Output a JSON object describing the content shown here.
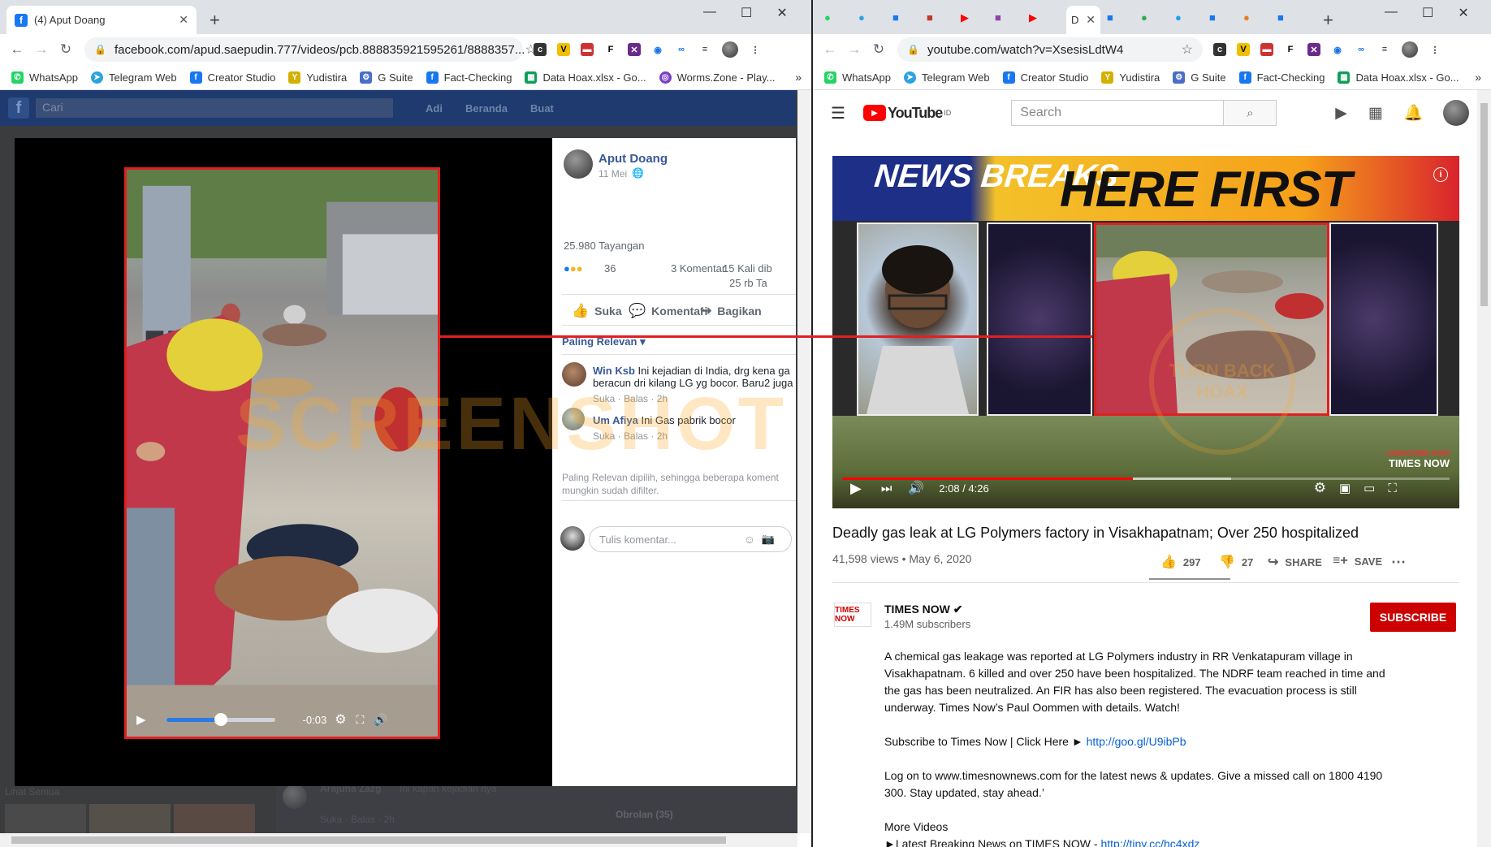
{
  "left": {
    "tab_title": "(4) Aput Doang",
    "url": "facebook.com/apud.saepudin.777/videos/pcb.888835921595261/8888357...",
    "bookmarks": [
      "WhatsApp",
      "Telegram Web",
      "Creator Studio",
      "Yudistira",
      "G Suite",
      "Fact-Checking",
      "Data Hoax.xlsx - Go...",
      "Worms.Zone - Play..."
    ],
    "fb_header": {
      "search": "Cari",
      "user": "Adi",
      "home": "Beranda",
      "create": "Buat"
    },
    "video": {
      "time": "-0:03",
      "progress": 0.5
    },
    "post": {
      "author": "Aput Doang",
      "date": "11 Mei",
      "views": "25.980 Tayangan",
      "reactions": "36",
      "comments": "3 Komentar",
      "shares": "15 Kali dib",
      "views2": "25 rb Ta",
      "like": "Suka",
      "comment": "Komentari",
      "share": "Bagikan",
      "sort": "Paling Relevan ▾",
      "comment_list": [
        {
          "author": "Win Ksb",
          "text": "Ini kejadian di India, drg kena ga",
          "text2": "beracun dri kilang LG yg bocor. Baru2 juga",
          "meta": "Suka · Balas · 2h"
        },
        {
          "author": "Um Afiya",
          "text": "Ini Gas pabrik bocor",
          "text2": "",
          "meta": "Suka · Balas · 2h"
        }
      ],
      "note1": "Paling Relevan dipilih, sehingga beberapa koment",
      "note2": "mungkin sudah difilter.",
      "input_placeholder": "Tulis komentar..."
    },
    "bottom_comment": {
      "author": "Arajuna Zazg",
      "text": "Ini kapan kejadian nya",
      "meta": "Suka · Balas · 2h"
    },
    "obrolan": "Obrolan (35)",
    "thumbs_label": "Lihat Semua",
    "watermark": "SCREENSHOT BY"
  },
  "right": {
    "tab_title": "D",
    "url": "youtube.com/watch?v=XsesisLdtW4",
    "bookmarks": [
      "WhatsApp",
      "Telegram Web",
      "Creator Studio",
      "Yudistira",
      "G Suite",
      "Fact-Checking",
      "Data Hoax.xlsx - Go..."
    ],
    "search_placeholder": "Search",
    "logo_word": "YouTube",
    "logo_region": "ID",
    "banner_left": "NEWS BREAKS",
    "banner_right": "HERE FIRST",
    "time": "2:08 / 4:26",
    "played": 0.478,
    "buffered": 0.64,
    "badge_top": "SUBSCRIBE NOW",
    "badge_bottom": "TIMES NOW",
    "stamp": "TURN BACK HOAX",
    "title": "Deadly gas leak at LG Polymers factory in Visakhapatnam; Over 250 hospitalized",
    "views": "41,598 views • May 6, 2020",
    "likes": "297",
    "dislikes": "27",
    "share": "SHARE",
    "save": "SAVE",
    "channel": "TIMES NOW ✔",
    "channel_logo": "TIMES NOW",
    "subscribers": "1.49M subscribers",
    "subscribe": "SUBSCRIBE",
    "desc1": "A chemical gas leakage was reported at LG Polymers industry in RR Venkatapuram village in Visakhapatnam. 6 killed and over 250 have been hospitalized. The NDRF team reached in time and the gas has been neutralized. An FIR has also been registered. The evacuation process is still underway.  Times Now’s Paul Oommen with details. Watch!",
    "desc2_text": "Subscribe to Times Now | Click Here ► ",
    "desc2_link": "http://goo.gl/U9ibPb",
    "desc3": "Log on to www.timesnownews.com for the latest news & updates. Give a missed call on 1800 4190 300. Stay updated, stay ahead.’",
    "desc4": "More Videos",
    "desc5_text": "►Latest Breaking News on TIMES NOW - ",
    "desc5_link": "http://tiny.cc/hc4xdz"
  }
}
